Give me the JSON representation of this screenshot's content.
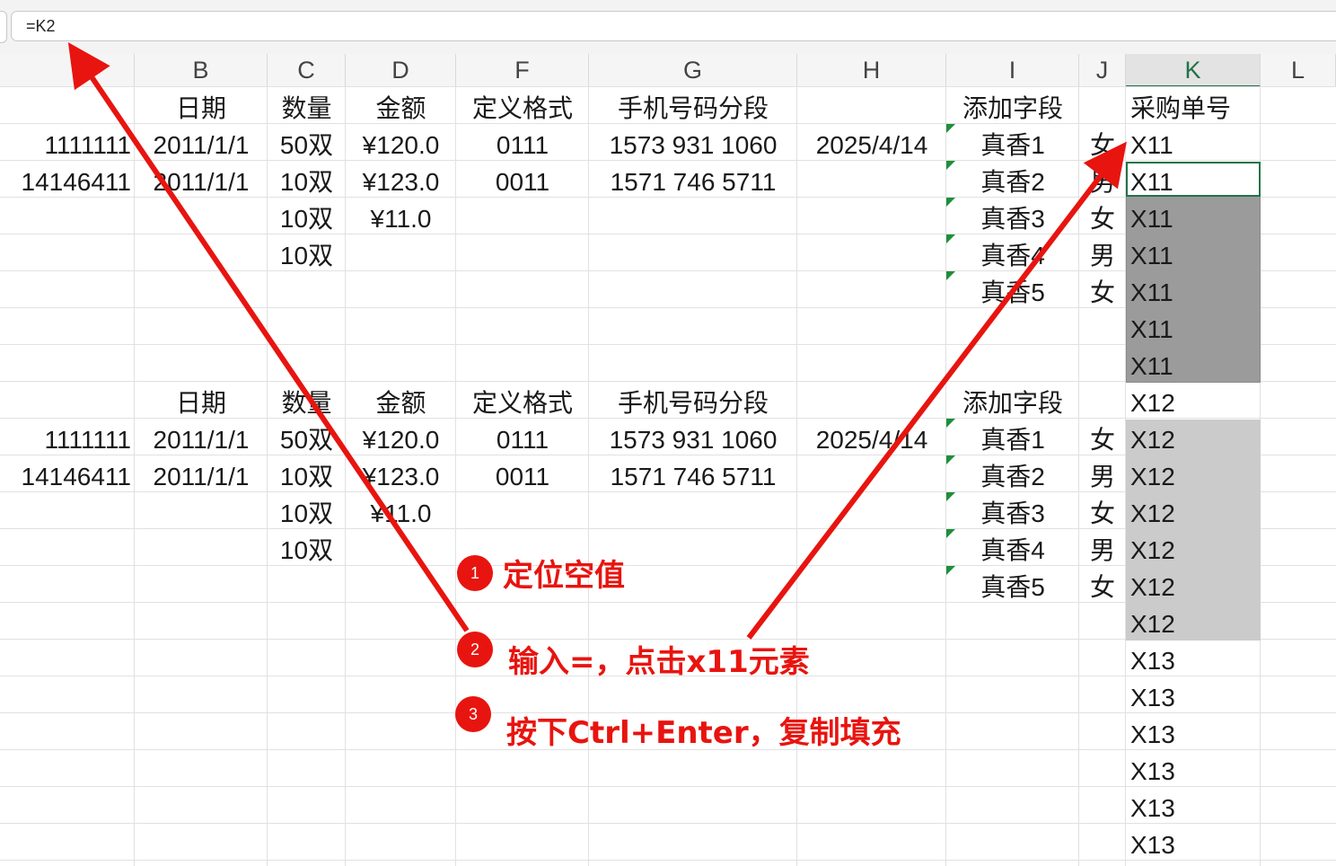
{
  "formula_bar": {
    "value": "=K2"
  },
  "columns": [
    {
      "key": "A",
      "label": ""
    },
    {
      "key": "B",
      "label": "B"
    },
    {
      "key": "C",
      "label": "C"
    },
    {
      "key": "D",
      "label": "D"
    },
    {
      "key": "F",
      "label": "F"
    },
    {
      "key": "G",
      "label": "G"
    },
    {
      "key": "H",
      "label": "H"
    },
    {
      "key": "I",
      "label": "I"
    },
    {
      "key": "J",
      "label": "J"
    },
    {
      "key": "K",
      "label": "K"
    },
    {
      "key": "L",
      "label": "L"
    }
  ],
  "rows": [
    [
      "",
      "日期",
      "数量",
      "金额",
      "定义格式",
      "手机号码分段",
      "",
      "添加字段",
      "",
      "采购单号"
    ],
    [
      "1111111",
      "2011/1/1",
      "50双",
      "¥120.0",
      "0111",
      "1573 931 1060",
      "2025/4/14",
      "真香1",
      "女",
      "X11"
    ],
    [
      "14146411",
      "2011/1/1",
      "10双",
      "¥123.0",
      "0011",
      "1571 746 5711",
      "",
      "真香2",
      "男",
      "X11"
    ],
    [
      "",
      "",
      "10双",
      "¥11.0",
      "",
      "",
      "",
      "真香3",
      "女",
      "X11"
    ],
    [
      "",
      "",
      "10双",
      "",
      "",
      "",
      "",
      "真香4",
      "男",
      "X11"
    ],
    [
      "",
      "",
      "",
      "",
      "",
      "",
      "",
      "真香5",
      "女",
      "X11"
    ],
    [
      "",
      "",
      "",
      "",
      "",
      "",
      "",
      "",
      "",
      "X11"
    ],
    [
      "",
      "",
      "",
      "",
      "",
      "",
      "",
      "",
      "",
      "X11"
    ],
    [
      "",
      "日期",
      "数量",
      "金额",
      "定义格式",
      "手机号码分段",
      "",
      "添加字段",
      "",
      "X12"
    ],
    [
      "1111111",
      "2011/1/1",
      "50双",
      "¥120.0",
      "0111",
      "1573 931 1060",
      "2025/4/14",
      "真香1",
      "女",
      "X12"
    ],
    [
      "14146411",
      "2011/1/1",
      "10双",
      "¥123.0",
      "0011",
      "1571 746 5711",
      "",
      "真香2",
      "男",
      "X12"
    ],
    [
      "",
      "",
      "10双",
      "¥11.0",
      "",
      "",
      "",
      "真香3",
      "女",
      "X12"
    ],
    [
      "",
      "",
      "10双",
      "",
      "",
      "",
      "",
      "真香4",
      "男",
      "X12"
    ],
    [
      "",
      "",
      "",
      "",
      "",
      "",
      "",
      "真香5",
      "女",
      "X12"
    ],
    [
      "",
      "",
      "",
      "",
      "",
      "",
      "",
      "",
      "",
      "X12"
    ],
    [
      "",
      "",
      "",
      "",
      "",
      "",
      "",
      "",
      "",
      "X13"
    ],
    [
      "",
      "",
      "",
      "",
      "",
      "",
      "",
      "",
      "",
      "X13"
    ],
    [
      "",
      "",
      "",
      "",
      "",
      "",
      "",
      "",
      "",
      "X13"
    ],
    [
      "",
      "",
      "",
      "",
      "",
      "",
      "",
      "",
      "",
      "X13"
    ],
    [
      "",
      "",
      "",
      "",
      "",
      "",
      "",
      "",
      "",
      "X13"
    ],
    [
      "",
      "",
      "",
      "",
      "",
      "",
      "",
      "",
      "",
      "X13"
    ]
  ],
  "annotations": {
    "step1": {
      "number": "1",
      "text": "定位空值"
    },
    "step2": {
      "number": "2",
      "text": "输入=，点击x11元素"
    },
    "step3": {
      "number": "3",
      "text": "按下Ctrl+Enter，复制填充"
    },
    "color": "#e8140f"
  }
}
